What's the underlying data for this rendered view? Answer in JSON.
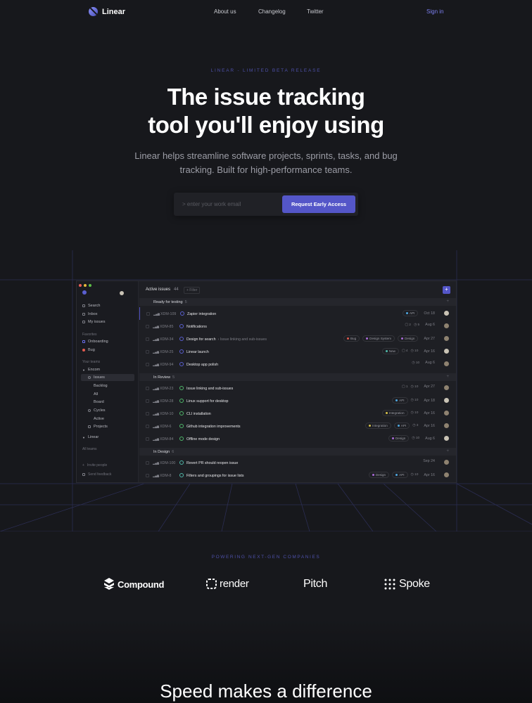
{
  "nav": {
    "logo": "Linear",
    "links": [
      "About us",
      "Changelog",
      "Twitter"
    ],
    "signin": "Sign in"
  },
  "hero": {
    "eyebrow": "LINEAR - LIMITED BETA RELEASE",
    "title_line1": "The issue tracking",
    "title_line2": "tool you'll enjoy using",
    "subtitle": "Linear helps streamline software projects, sprints, tasks, and bug tracking. Built for high-performance teams.",
    "email_placeholder": "> enter your work email",
    "cta": "Request Early Access"
  },
  "app": {
    "sidebar": {
      "search": "Search",
      "inbox": "Inbox",
      "my_issues": "My issues",
      "favorites_label": "Favorites",
      "onboarding": "Onboarding",
      "bug": "Bug",
      "your_teams_label": "Your teams",
      "team1": "Encom",
      "issues": "Issues",
      "backlog": "Backlog",
      "all": "All",
      "board": "Board",
      "cycles": "Cycles",
      "active": "Active",
      "projects": "Projects",
      "team2": "Linear",
      "all_teams": "All teams",
      "invite": "Invite people",
      "feedback": "Send feedback"
    },
    "topbar": {
      "title": "Active issues",
      "count": "44",
      "filter": "+ Filter",
      "add": "+"
    },
    "groups": [
      {
        "label": "Ready for testing",
        "count": "5"
      },
      {
        "label": "In Review",
        "count": "5"
      },
      {
        "label": "In Design",
        "count": "6"
      }
    ],
    "rows": [
      {
        "id": "XDM-109",
        "title": "Zapier integration",
        "sub": "",
        "tags": [
          "API"
        ],
        "comments": "",
        "points": "",
        "date": "Oct 18"
      },
      {
        "id": "XDM-85",
        "title": "Notifications",
        "sub": "",
        "tags": [],
        "comments": "2",
        "points": "5",
        "date": "Aug 6"
      },
      {
        "id": "XDM-34",
        "title": "Design for search",
        "sub": "› Issue linking and sub-issues",
        "tags": [
          "Bug",
          "Design System",
          "Design"
        ],
        "comments": "",
        "points": "",
        "date": "Apr 27"
      },
      {
        "id": "XDM-25",
        "title": "Linear launch",
        "sub": "",
        "tags": [
          "New"
        ],
        "comments": "4",
        "points": "10",
        "date": "Apr 16"
      },
      {
        "id": "XDM-94",
        "title": "Desktop app polish",
        "sub": "",
        "tags": [],
        "comments": "",
        "points": "10",
        "date": "Aug 6"
      },
      {
        "id": "XDM-23",
        "title": "Issue linking and sub-issues",
        "sub": "",
        "tags": [],
        "comments": "1",
        "points": "10",
        "date": "Apr 27"
      },
      {
        "id": "XDM-28",
        "title": "Linux support for desktop",
        "sub": "",
        "tags": [
          "API"
        ],
        "comments": "",
        "points": "10",
        "date": "Apr 18"
      },
      {
        "id": "XDM-10",
        "title": "CLI installation",
        "sub": "",
        "tags": [
          "Integration"
        ],
        "comments": "",
        "points": "10",
        "date": "Apr 16"
      },
      {
        "id": "XDM-6",
        "title": "Github integration improvements",
        "sub": "",
        "tags": [
          "Integration",
          "API"
        ],
        "comments": "",
        "points": "3",
        "date": "Apr 16"
      },
      {
        "id": "XDM-84",
        "title": "Offline mode design",
        "sub": "",
        "tags": [
          "Design"
        ],
        "comments": "",
        "points": "10",
        "date": "Aug 6"
      },
      {
        "id": "XDM-100",
        "title": "Revert PR should reopen issue",
        "sub": "",
        "tags": [],
        "comments": "",
        "points": "",
        "date": "Sep 24"
      },
      {
        "id": "XDM-8",
        "title": "Filters and groupings for issue lists",
        "sub": "",
        "tags": [
          "Design",
          "API"
        ],
        "comments": "",
        "points": "10",
        "date": "Apr 16"
      }
    ]
  },
  "powering": {
    "label": "POWERING NEXT-GEN COMPANIES",
    "brands": [
      "Compound",
      "render",
      "Pitch",
      "Spoke"
    ]
  },
  "speed": {
    "title": "Speed makes a difference"
  },
  "colors": {
    "accent": "#5456c8",
    "eyebrow": "#4d50a8",
    "bg": "#17181c"
  }
}
